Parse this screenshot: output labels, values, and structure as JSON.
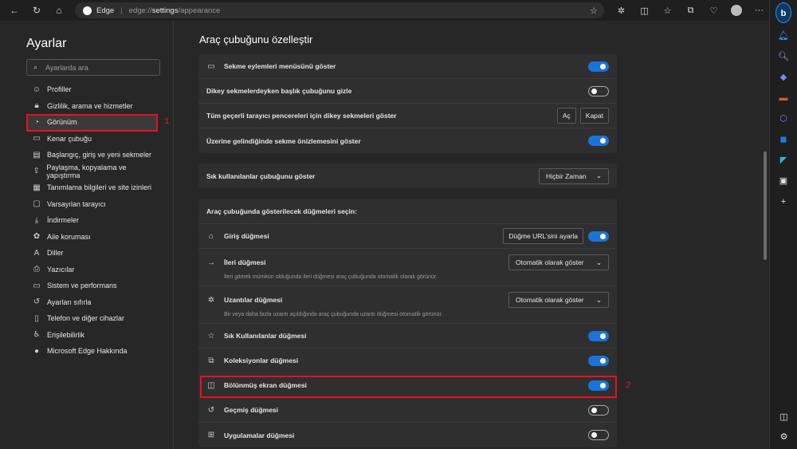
{
  "browser": {
    "brand": "Edge",
    "url_prefix": "edge://",
    "url_bold": "settings",
    "url_suffix": "/appearance"
  },
  "nav": {
    "title": "Ayarlar",
    "search_placeholder": "Ayarlarda ara",
    "items": [
      {
        "label": "Profiller",
        "icon": "profile-icon"
      },
      {
        "label": "Gizlilik, arama ve hizmetler",
        "icon": "lock-icon"
      },
      {
        "label": "Görünüm",
        "icon": "palette-icon",
        "active": true
      },
      {
        "label": "Kenar çubuğu",
        "icon": "sidebar-icon"
      },
      {
        "label": "Başlangıç, giriş ve yeni sekmeler",
        "icon": "start-icon"
      },
      {
        "label": "Paylaşma, kopyalama ve yapıştırma",
        "icon": "share-icon"
      },
      {
        "label": "Tanımlama bilgileri ve site izinleri",
        "icon": "cookie-icon"
      },
      {
        "label": "Varsayılan tarayıcı",
        "icon": "browser-icon"
      },
      {
        "label": "İndirmeler",
        "icon": "download-icon"
      },
      {
        "label": "Aile koruması",
        "icon": "family-icon"
      },
      {
        "label": "Diller",
        "icon": "language-icon"
      },
      {
        "label": "Yazıcılar",
        "icon": "printer-icon"
      },
      {
        "label": "Sistem ve performans",
        "icon": "laptop-icon"
      },
      {
        "label": "Ayarları sıfırla",
        "icon": "reset-icon"
      },
      {
        "label": "Telefon ve diğer cihazlar",
        "icon": "phone-icon"
      },
      {
        "label": "Erişilebilirlik",
        "icon": "accessibility-icon"
      },
      {
        "label": "Microsoft Edge Hakkında",
        "icon": "edge-icon"
      }
    ]
  },
  "annotations": {
    "one": "1",
    "two": "2"
  },
  "main": {
    "title": "Araç çubuğunu özelleştir",
    "card1": [
      {
        "label": "Sekme eylemleri menüsünü göster",
        "toggle": true
      },
      {
        "label": "Dikey sekmelerdeyken başlık çubuğunu gizle",
        "toggle": false
      },
      {
        "label": "Tüm geçerli tarayıcı pencereleri için dikey sekmeleri göster",
        "btn1": "Aç",
        "btn2": "Kapat"
      },
      {
        "label": "Üzerine gelindiğinde sekme önizlemesini göster",
        "toggle": true
      }
    ],
    "favorites_bar": {
      "label": "Sık kullanılanlar çubuğunu göster",
      "value": "Hiçbir Zaman"
    },
    "buttons_header": "Araç çubuğunda gösterilecek düğmeleri seçin:",
    "home": {
      "label": "Giriş düğmesi",
      "btn": "Düğme URL'sini ayarla",
      "toggle": true
    },
    "forward": {
      "label": "İleri düğmesi",
      "value": "Otomatik olarak göster",
      "desc": "İleri gitmek mümkün olduğunda ileri düğmesi araç çubuğunda otomatik olarak görünür."
    },
    "extensions": {
      "label": "Uzantılar düğmesi",
      "value": "Otomatik olarak göster",
      "desc": "Bir veya daha fazla uzantı açıldığında araç çubuğunda uzantı düğmesi otomatik görünür."
    },
    "toggles": [
      {
        "label": "Sık Kullanılanlar düğmesi",
        "toggle": true,
        "icon": "favorites-icon"
      },
      {
        "label": "Koleksiyonlar düğmesi",
        "toggle": true,
        "icon": "collections-icon"
      },
      {
        "label": "Bölünmüş ekran düğmesi",
        "toggle": true,
        "icon": "split-screen-icon"
      },
      {
        "label": "Geçmiş düğmesi",
        "toggle": false,
        "icon": "history-icon"
      },
      {
        "label": "Uygulamalar düğmesi",
        "toggle": false,
        "icon": "apps-icon"
      }
    ]
  },
  "colors": {
    "accent": "#1a73d9",
    "highlight": "#e81123"
  }
}
